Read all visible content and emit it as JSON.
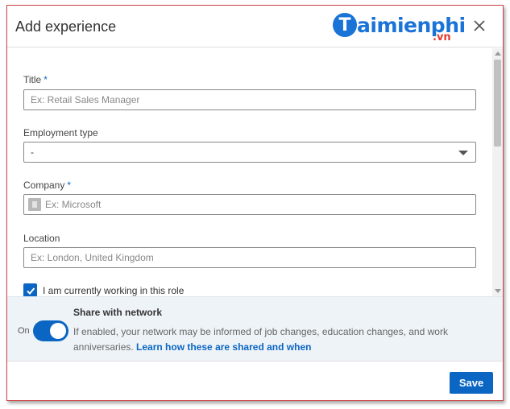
{
  "dialog": {
    "title": "Add experience",
    "close_icon": "close-icon"
  },
  "watermark": {
    "letter": "T",
    "text": "aimienphi",
    "suffix": ".vn",
    "color": "#1a73d6",
    "suffix_color": "#e23b2e"
  },
  "form": {
    "title": {
      "label": "Title",
      "required": "*",
      "placeholder": "Ex: Retail Sales Manager"
    },
    "employment_type": {
      "label": "Employment type",
      "value": "-",
      "icon": "chevron-down-icon"
    },
    "company": {
      "label": "Company",
      "required": "*",
      "placeholder": "Ex: Microsoft",
      "icon": "company-logo-icon"
    },
    "location": {
      "label": "Location",
      "placeholder": "Ex: London, United Kingdom"
    },
    "currently_working": {
      "label": "I am currently working in this role",
      "checked": true
    }
  },
  "share": {
    "title": "Share with network",
    "toggle_label": "On",
    "toggle_on": true,
    "description": "If enabled, your network may be informed of job changes, education changes, and work anniversaries. ",
    "link": "Learn how these are shared and when"
  },
  "footer": {
    "save_label": "Save"
  },
  "colors": {
    "accent": "#0a66c2",
    "share_bg": "#eef3f8"
  }
}
